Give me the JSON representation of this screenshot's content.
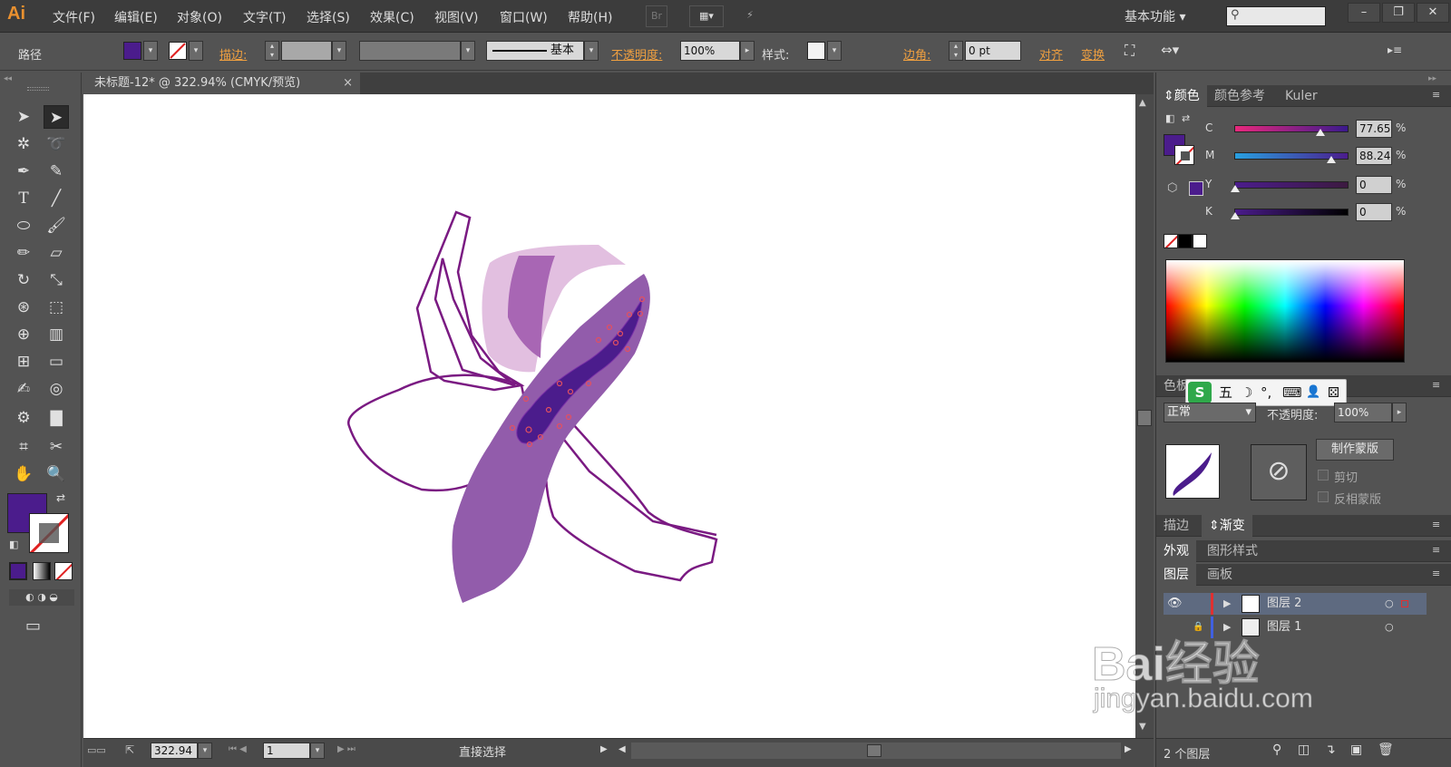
{
  "app": {
    "logo": "Ai",
    "workspace": "基本功能"
  },
  "menu": {
    "items": [
      "文件(F)",
      "编辑(E)",
      "对象(O)",
      "文字(T)",
      "选择(S)",
      "效果(C)",
      "视图(V)",
      "窗口(W)",
      "帮助(H)"
    ],
    "br_label": "Br"
  },
  "control": {
    "object_type": "路径",
    "stroke_label": "描边:",
    "stroke_profile": "基本",
    "opacity_label": "不透明度:",
    "opacity_value": "100%",
    "style_label": "样式:",
    "corner_label": "边角:",
    "corner_value": "0 pt",
    "align_label": "对齐",
    "transform_label": "变换",
    "fill_color": "#4b1c8c"
  },
  "document": {
    "tab_title": "未标题-12* @ 322.94% (CMYK/预览)",
    "close": "×"
  },
  "status": {
    "zoom": "322.94",
    "artboard": "1",
    "tool": "直接选择"
  },
  "color_panel": {
    "tabs": [
      "颜色",
      "颜色参考",
      "Kuler"
    ],
    "channels": [
      {
        "label": "C",
        "value": "77.65",
        "fraction": 0.78
      },
      {
        "label": "M",
        "value": "88.24",
        "fraction": 0.88
      },
      {
        "label": "Y",
        "value": "0",
        "fraction": 0
      },
      {
        "label": "K",
        "value": "0",
        "fraction": 0
      }
    ],
    "pct": "%"
  },
  "transparency_panel": {
    "tab_short": "色板",
    "blend_mode": "正常",
    "opacity_label": "不透明度:",
    "opacity_value": "100%",
    "make_mask": "制作蒙版",
    "clip": "剪切",
    "invert_mask": "反相蒙版"
  },
  "ime_bar": {
    "items": [
      "五",
      "☽",
      "°,",
      "⌨",
      "👤",
      "⚄"
    ]
  },
  "stroke_gradient_tabs": [
    "描边",
    "渐变"
  ],
  "appearance_tabs": [
    "外观",
    "图形样式"
  ],
  "layers_panel": {
    "tabs": [
      "图层",
      "画板"
    ],
    "layers": [
      {
        "name": "图层 2"
      },
      {
        "name": "图层 1"
      }
    ],
    "count": "2 个图层"
  },
  "watermark": {
    "brand": "Bai经验",
    "url": "jingyan.baidu.com"
  }
}
